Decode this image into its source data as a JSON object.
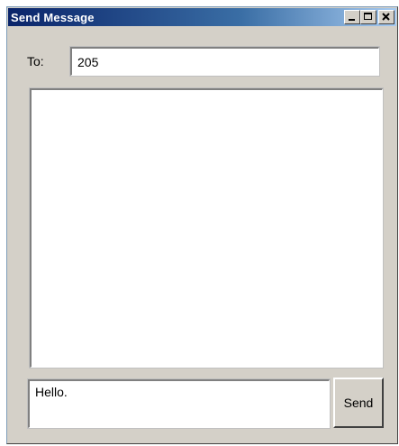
{
  "window": {
    "title": "Send Message",
    "controls": {
      "minimize_icon": "minimize-icon",
      "maximize_icon": "maximize-icon",
      "close_icon": "close-icon"
    }
  },
  "form": {
    "to_label": "To:",
    "to_value": "205",
    "message_history": "",
    "compose_value": "Hello.",
    "send_label": "Send"
  },
  "colors": {
    "title_bar_start": "#0a246a",
    "title_bar_end": "#a6caf0",
    "window_face": "#d4d0c8"
  }
}
